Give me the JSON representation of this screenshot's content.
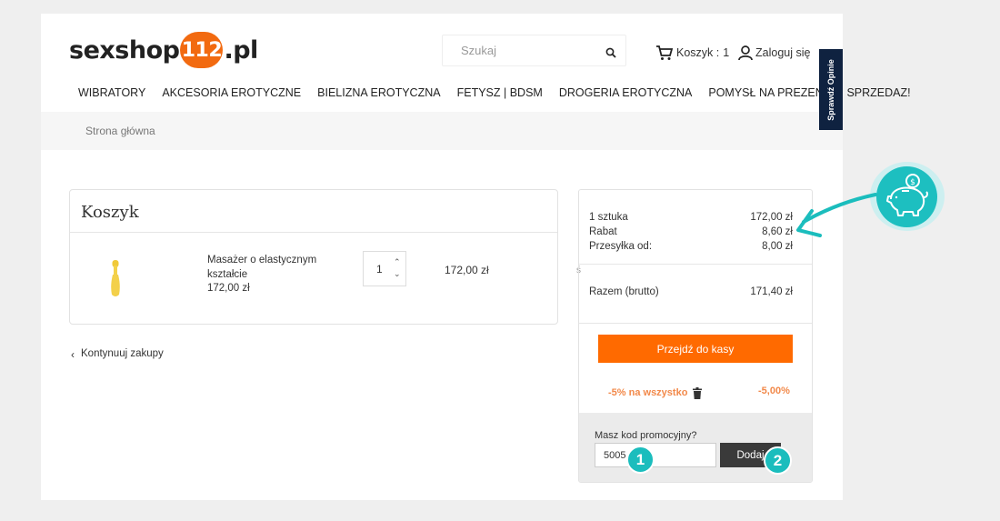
{
  "header": {
    "logo_left": "sexshop",
    "logo_badge": "112",
    "logo_right": ".pl",
    "search_placeholder": "Szukaj",
    "cart_label": "Koszyk :",
    "cart_count": "1",
    "login_label": "Zaloguj się"
  },
  "nav": {
    "items": [
      "WIBRATORY",
      "AKCESORIA EROTYCZNE",
      "BIELIZNA EROTYCZNA",
      "FETYSZ | BDSM",
      "DROGERIA EROTYCZNA",
      "POMYSŁ NA PREZENT",
      "SPRZEDAZ!"
    ]
  },
  "breadcrumb": {
    "home": "Strona główna"
  },
  "cart": {
    "title": "Koszyk",
    "item": {
      "name": "Masażer o elastycznym kształcie",
      "price": "172,00 zł",
      "quantity": "1",
      "line_total": "172,00 zł"
    },
    "continue_label": "Kontynuuj zakupy"
  },
  "summary": {
    "rows": [
      {
        "label": "1 sztuka",
        "value": "172,00 zł"
      },
      {
        "label": "Rabat",
        "value": "8,60 zł"
      },
      {
        "label": "Przesyłka od:",
        "value": "8,00 zł"
      }
    ],
    "total_label": "Razem (brutto)",
    "total_value": "171,40 zł",
    "checkout_label": "Przejdź do kasy",
    "promo_applied": "-5% na wszystko",
    "promo_percent": "-5,00%",
    "promo_prompt": "Masz kod promocyjny?",
    "promo_value": "5005",
    "promo_button": "Dodaj"
  },
  "side_tab": "Sprawdź Opinie",
  "stray_char": "ś",
  "markers": [
    "1",
    "2"
  ],
  "colors": {
    "accent": "#ff6a00",
    "logo_badge": "#f26a10",
    "teal": "#1bbdbd",
    "side_tab": "#0f2240"
  }
}
